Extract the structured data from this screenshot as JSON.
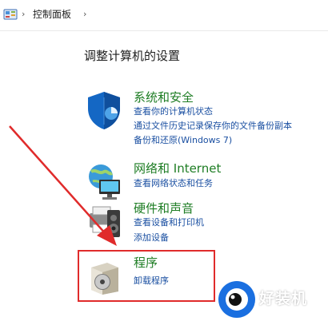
{
  "breadcrumb": {
    "location": "控制面板",
    "separator_icon": "chevron-right-icon"
  },
  "heading": "调整计算机的设置",
  "categories": [
    {
      "icon": "shield-icon",
      "title": "系统和安全",
      "links": [
        "查看你的计算机状态",
        "通过文件历史记录保存你的文件备份副本",
        "备份和还原(Windows 7)"
      ]
    },
    {
      "icon": "network-globe-icon",
      "title": "网络和 Internet",
      "links": [
        "查看网络状态和任务"
      ]
    },
    {
      "icon": "printer-speaker-icon",
      "title": "硬件和声音",
      "links": [
        "查看设备和打印机",
        "添加设备"
      ]
    },
    {
      "icon": "programs-disc-icon",
      "title": "程序",
      "links": [
        "卸载程序"
      ]
    }
  ],
  "annotation": {
    "highlight_color": "#e02b2b",
    "arrow_color": "#e02b2b"
  },
  "watermark": {
    "text": "好装机",
    "logo": "eye-logo-icon"
  },
  "colors": {
    "title_green": "#1e7d24",
    "link_blue": "#1a4fa1"
  }
}
